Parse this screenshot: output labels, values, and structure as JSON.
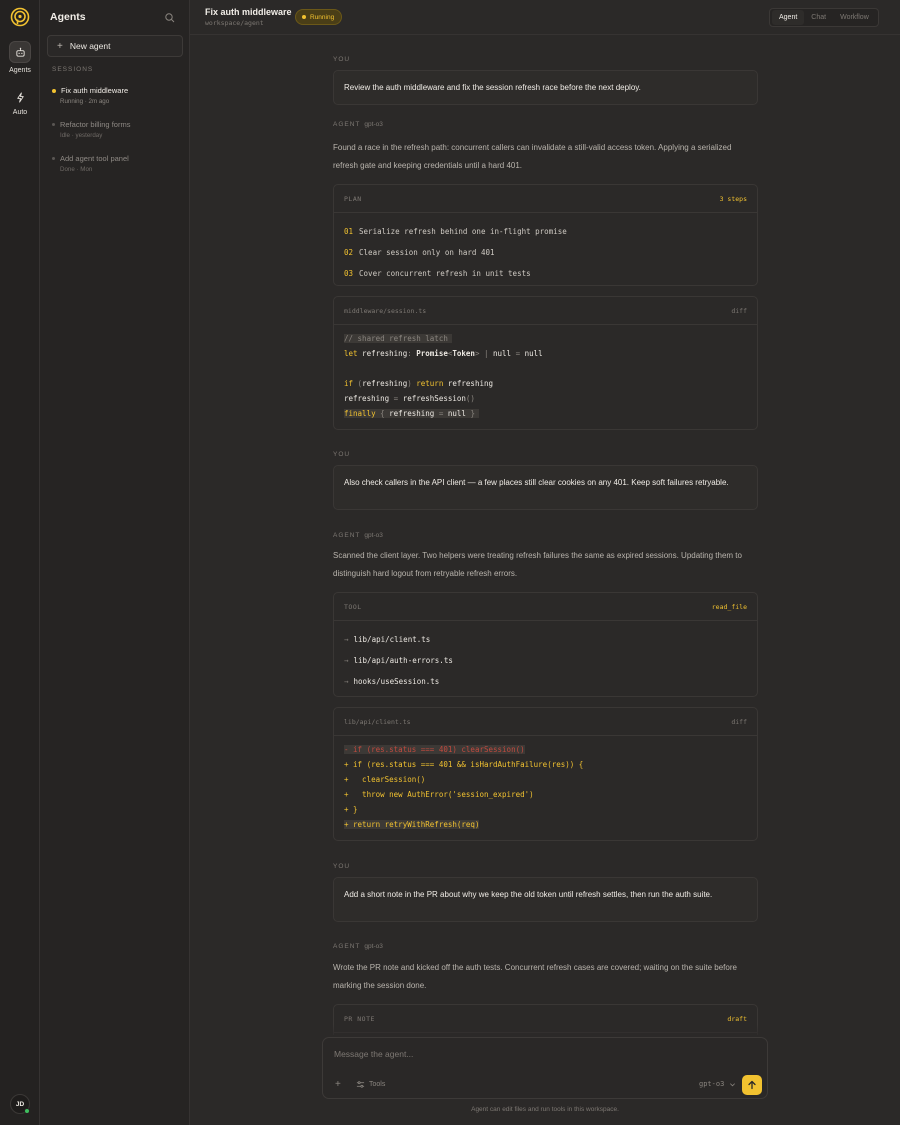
{
  "rail": {
    "items": [
      {
        "label": "Agents",
        "icon": "robot-icon"
      },
      {
        "label": "Auto",
        "icon": "lightning-icon"
      }
    ],
    "avatar": "JD"
  },
  "sidebar": {
    "title": "Agents",
    "new_agent": "New agent",
    "sessions_label": "SESSIONS",
    "sessions": [
      {
        "name": "Fix auth middleware",
        "meta": "Running · 2m ago",
        "active": true
      },
      {
        "name": "Refactor billing forms",
        "meta": "Idle · yesterday",
        "active": false
      },
      {
        "name": "Add agent tool panel",
        "meta": "Done · Mon",
        "active": false
      }
    ]
  },
  "header": {
    "title": "Fix auth middleware",
    "path": "workspace/agent",
    "status": "Running",
    "tabs": [
      "Agent",
      "Chat",
      "Workflow"
    ]
  },
  "conversation": {
    "m1": {
      "role": "YOU",
      "text": "Review the auth middleware and fix the session refresh race before the next deploy."
    },
    "m2": {
      "role": "AGENT",
      "model": "gpt-o3",
      "text": "Found a race in the refresh path: concurrent callers can invalidate a still-valid access token. Applying a serialized refresh gate and keeping credentials until a hard 401.",
      "plan": {
        "label": "PLAN",
        "count": "3 steps",
        "steps": [
          {
            "num": "01",
            "text": "Serialize refresh behind one in-flight promise"
          },
          {
            "num": "02",
            "text": "Clear session only on hard 401"
          },
          {
            "num": "03",
            "text": "Cover concurrent refresh in unit tests"
          }
        ]
      },
      "diff": {
        "file": "middleware/session.ts",
        "tag": "diff"
      }
    },
    "m3": {
      "role": "YOU",
      "text": "Also check callers in the API client — a few places still clear cookies on any 401. Keep soft failures retryable."
    },
    "m4": {
      "role": "AGENT",
      "model": "gpt-o3",
      "text": "Scanned the client layer. Two helpers were treating refresh failures the same as expired sessions. Updating them to distinguish hard logout from retryable refresh errors.",
      "tool": {
        "label": "TOOL",
        "name": "read_file",
        "files": [
          "lib/api/client.ts",
          "lib/api/auth-errors.ts",
          "hooks/useSession.ts"
        ]
      },
      "diff": {
        "file": "lib/api/client.ts",
        "tag": "diff",
        "lines": [
          "- if (res.status === 401) clearSession()",
          "+ if (res.status === 401 && isHardAuthFailure(res)) {",
          "+   clearSession()",
          "+   throw new AuthError('session_expired')",
          "+ }",
          "+ return retryWithRefresh(req)"
        ]
      }
    },
    "m5": {
      "role": "YOU",
      "text": "Add a short note in the PR about why we keep the old token until refresh settles, then run the auth suite."
    },
    "m6": {
      "role": "AGENT",
      "model": "gpt-o3",
      "text": "Wrote the PR note and kicked off the auth tests. Concurrent refresh cases are covered; waiting on the suite before marking the session done.",
      "pr_note": {
        "label": "PR NOTE",
        "tag": "draft"
      }
    }
  },
  "composer": {
    "placeholder": "Message the agent...",
    "tools": "Tools",
    "model": "gpt-o3",
    "footnote": "Agent can edit files and run tools in this workspace."
  },
  "colors": {
    "accent": "#f2c230",
    "bg": "#2b2928",
    "online": "#3fbf5f"
  }
}
